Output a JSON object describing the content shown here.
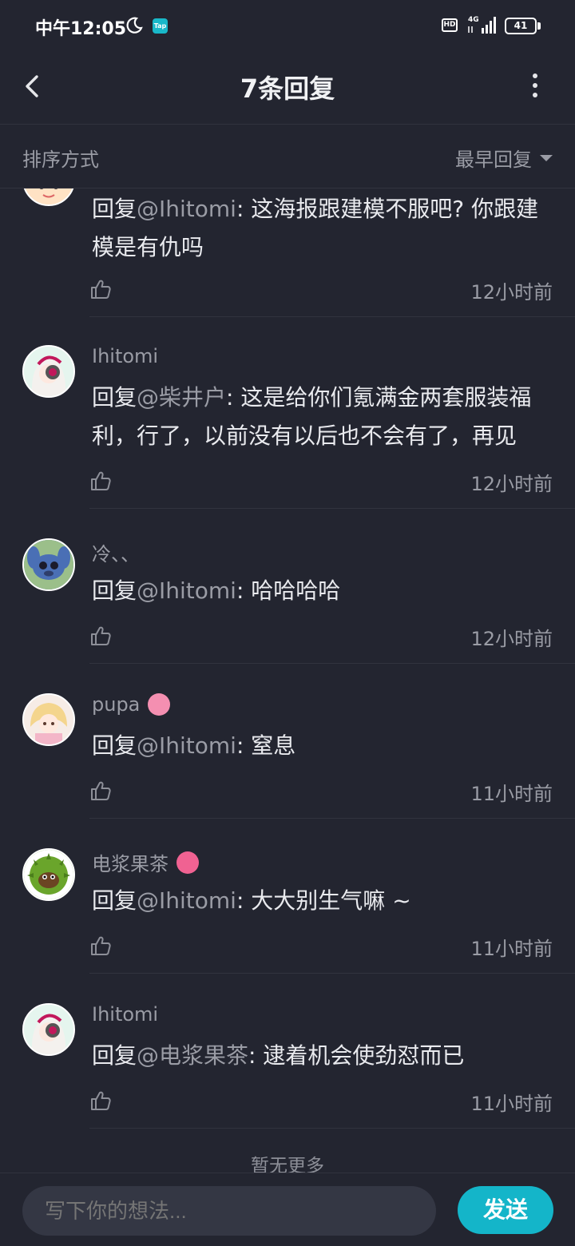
{
  "status_bar": {
    "time": "中午12:05",
    "tap_label": "Tap",
    "hd_label": "HD",
    "network_label": "4G",
    "battery": "41"
  },
  "nav": {
    "title": "7条回复"
  },
  "sort": {
    "label": "排序方式",
    "selected": "最早回复"
  },
  "replies": [
    {
      "username": "",
      "prefix": "回复",
      "mention": "@Ihitomi",
      "text": ": 这海报跟建模不服吧? 你跟建模是有仇吗",
      "time": "12小时前",
      "avatar": "cartoon-face-avatar"
    },
    {
      "username": "Ihitomi",
      "prefix": "回复",
      "mention": "@柴井户",
      "text": ": 这是给你们氪满金两套服装福利，行了，以前没有以后也不会有了，再见",
      "time": "12小时前",
      "avatar": "anime-girl-headphones-avatar"
    },
    {
      "username": "冷、、",
      "prefix": "回复",
      "mention": "@Ihitomi",
      "text": ": 哈哈哈哈",
      "time": "12小时前",
      "avatar": "stitch-avatar"
    },
    {
      "username": "pupa",
      "prefix": "回复",
      "mention": "@Ihitomi",
      "text": ": 窒息",
      "time": "11小时前",
      "avatar": "anime-girl-pink-avatar",
      "badge_color": "#f48fb1"
    },
    {
      "username": "电浆果茶",
      "prefix": "回复",
      "mention": "@Ihitomi",
      "text": ": 大大别生气嘛 ~",
      "time": "11小时前",
      "avatar": "durian-character-avatar",
      "badge_color": "#f06292"
    },
    {
      "username": "Ihitomi",
      "prefix": "回复",
      "mention": "@电浆果茶",
      "text": ": 逮着机会使劲怼而已",
      "time": "11小时前",
      "avatar": "anime-girl-headphones-avatar"
    }
  ],
  "footer": {
    "no_more": "暂无更多"
  },
  "composer": {
    "placeholder": "写下你的想法...",
    "send_label": "发送"
  }
}
